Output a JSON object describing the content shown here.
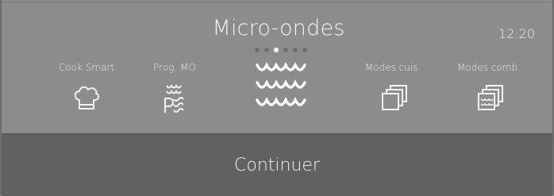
{
  "header": {
    "title": "Micro-ondes",
    "time": "12:20"
  },
  "carousel": {
    "page_count": 6,
    "active_index": 2
  },
  "modes": [
    {
      "label": "Cook Smart",
      "icon": "chef-hat-icon"
    },
    {
      "label": "Prog. MO",
      "icon": "microwave-program-icon"
    },
    {
      "label": "",
      "icon": "microwave-waves-icon",
      "selected": true
    },
    {
      "label": "Modes cuis.",
      "icon": "stacked-squares-icon"
    },
    {
      "label": "Modes comb.",
      "icon": "stacked-squares-waves-icon"
    }
  ],
  "footer": {
    "continue_label": "Continuer"
  }
}
